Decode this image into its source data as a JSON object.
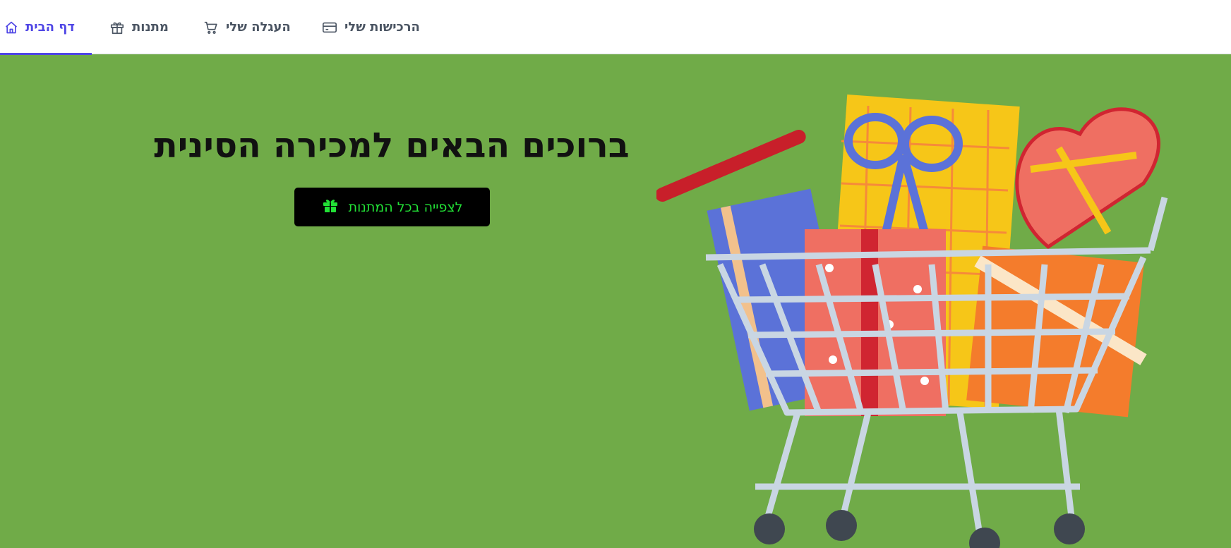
{
  "nav": {
    "tabs": [
      {
        "label": "דף הבית",
        "icon": "home-icon",
        "active": true
      },
      {
        "label": "מתנות",
        "icon": "gift-icon",
        "active": false
      },
      {
        "label": "העגלה שלי",
        "icon": "cart-icon",
        "active": false
      },
      {
        "label": "הרכישות שלי",
        "icon": "credit-card-icon",
        "active": false
      }
    ]
  },
  "hero": {
    "title": "ברוכים הבאים למכירה הסינית",
    "cta_label": "לצפייה בכל המתנות",
    "cta_icon": "gift-icon"
  },
  "colors": {
    "background": "#70ab48",
    "nav_active": "#4f46e5",
    "nav_text": "#4b5563",
    "cta_background": "#000000",
    "cta_text": "#22e036"
  },
  "illustration": {
    "icon": "shopping-cart-with-gifts-illustration"
  }
}
